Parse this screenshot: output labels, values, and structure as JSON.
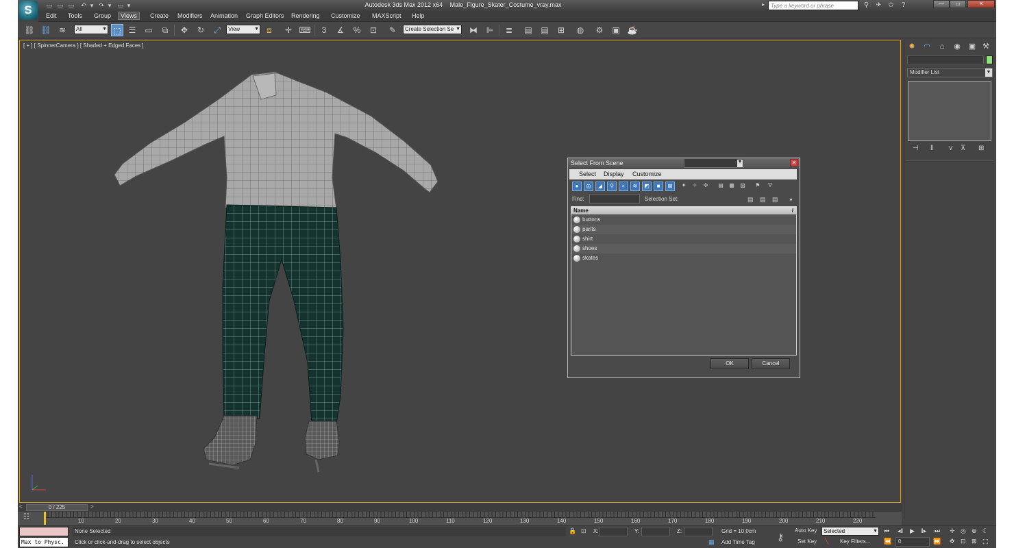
{
  "app": {
    "logo_glyph": "S",
    "title_product": "Autodesk 3ds Max  2012 x64",
    "title_file": "Male_Figure_Skater_Costume_vray.max",
    "search_placeholder": "Type a keyword or phrase",
    "quick_access": [
      "▭",
      "▭",
      "▭",
      "↶",
      "▾",
      "↷",
      "▾",
      "▭",
      "▾"
    ],
    "title_icons": [
      "⚲",
      "✈",
      "✩",
      "?"
    ],
    "window_buttons": {
      "minimize": "—",
      "maximize": "▭",
      "close": "✕"
    }
  },
  "menu": [
    "Edit",
    "Tools",
    "Group",
    "Views",
    "Create",
    "Modifiers",
    "Animation",
    "Graph Editors",
    "Rendering",
    "Customize",
    "MAXScript",
    "Help"
  ],
  "toolbar": {
    "filter_value": "All",
    "refcoord_value": "View",
    "selection_set_value": "Create Selection Se",
    "snaps": [
      "3",
      "∡",
      "%",
      "⊡"
    ],
    "icons": {
      "link": "⛓",
      "unlink": "⛓",
      "bind": "≋",
      "select": "⬚",
      "select_by_name": "☰",
      "rect_region": "▭",
      "window_cross": "⧉",
      "move": "✥",
      "rotate": "↻",
      "scale": "⤢",
      "pivot": "⧈",
      "manipulate": "✛",
      "keyboard": "⌨",
      "mirror": "⧓",
      "align": "⊫",
      "layers": "≣",
      "graph": "▤",
      "schematic": "⊞",
      "material": "◍",
      "render_setup": "⚙",
      "render_frame": "▣",
      "render": "☕",
      "edit_named": "✎"
    }
  },
  "viewport": {
    "label": "[ + ] [ SpinnerCamera ] [ Shaded + Edged Faces ]",
    "colors": {
      "border": "#d8a23a",
      "background": "#444444",
      "shirt": "#9a9a9a",
      "pants": "#14322e"
    }
  },
  "dialog": {
    "title": "Select From Scene",
    "close_glyph": "✕",
    "menu": [
      "Select",
      "Display",
      "Customize"
    ],
    "tool_icons": [
      "●",
      "◎",
      "◢",
      "⚲",
      "◐",
      "≋",
      "◩",
      "■",
      "⊠",
      "✦",
      "✧",
      "✣",
      "▤",
      "▦",
      "▨",
      "⚑",
      "⛛"
    ],
    "find_label": "Find:",
    "selection_set_label": "Selection Set:",
    "column_header": "Name",
    "column_sort_glyph": "/",
    "items": [
      "buttons",
      "pants",
      "shirt",
      "shoes",
      "skates"
    ],
    "ok": "OK",
    "cancel": "Cancel"
  },
  "command_panel": {
    "tabs": [
      "✸",
      "◠",
      "⌂",
      "◉",
      "▣",
      "⚒"
    ],
    "swatch_color": "#8de07a",
    "modifier_list": "Modifier List",
    "stack_icons": [
      "⊣",
      "‖",
      "⋎",
      "⊼",
      "⊞"
    ]
  },
  "timeline": {
    "frame_display": "0 / 225",
    "ticks": [
      "10",
      "20",
      "30",
      "40",
      "50",
      "60",
      "70",
      "80",
      "90",
      "100",
      "110",
      "120",
      "130",
      "140",
      "150",
      "160",
      "170",
      "180",
      "190",
      "200",
      "210",
      "220"
    ]
  },
  "status": {
    "maxscript_label": "Max to Physc.",
    "selection": "None Selected",
    "prompt": "Click or click-and-drag to select objects",
    "x_label": "X:",
    "y_label": "Y:",
    "z_label": "Z:",
    "grid": "Grid = 10,0cm",
    "add_time_tag": "Add Time Tag",
    "auto_key": "Auto Key",
    "set_key": "Set Key",
    "key_mode": "Selected",
    "key_filters": "Key Filters...",
    "current_frame": "0",
    "icons": {
      "lock": "🔒",
      "abs": "⊡",
      "key": "⚷",
      "time_tag": "▦",
      "set_key_line": "╲"
    },
    "playback": [
      "⏮",
      "◂‖",
      "▶",
      "‖▸",
      "⏭"
    ],
    "playback2": [
      "⏪",
      "⏩"
    ],
    "nav": [
      "✛",
      "◎",
      "⊕",
      "☾",
      "✥",
      "⊡",
      "⊠",
      "⬚"
    ]
  }
}
